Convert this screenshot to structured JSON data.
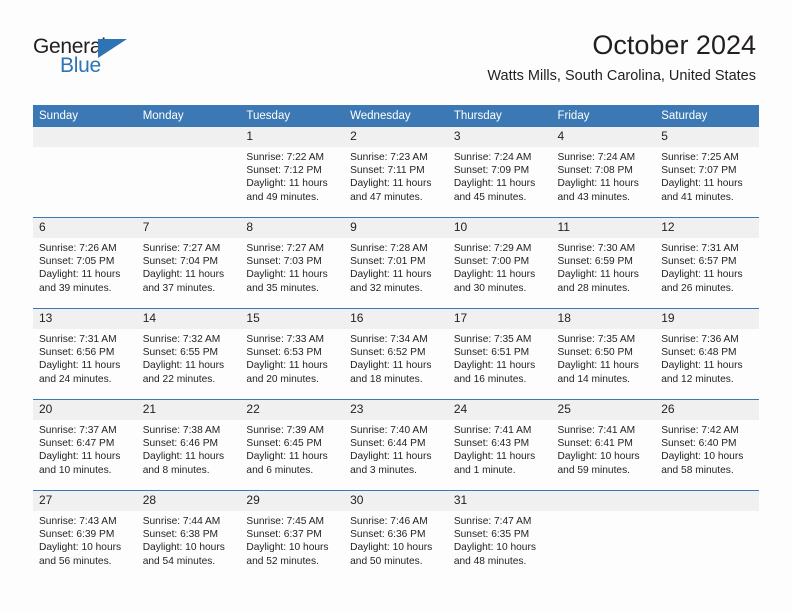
{
  "brand": {
    "name_part1": "General",
    "name_part2": "Blue",
    "accent_color": "#2E74B5"
  },
  "header": {
    "title": "October 2024",
    "subtitle": "Watts Mills, South Carolina, United States"
  },
  "theme": {
    "header_blue": "#3C78B4",
    "daynum_bg": "#F0F0F0",
    "page_bg": "#FDFDFD",
    "text": "#231F20"
  },
  "weekday_headers": [
    "Sunday",
    "Monday",
    "Tuesday",
    "Wednesday",
    "Thursday",
    "Friday",
    "Saturday"
  ],
  "labels": {
    "sunrise": "Sunrise:",
    "sunset": "Sunset:",
    "daylight": "Daylight:"
  },
  "weeks": [
    [
      {
        "day": "",
        "sunrise": "",
        "sunset": "",
        "daylight_1": "",
        "daylight_2": ""
      },
      {
        "day": "",
        "sunrise": "",
        "sunset": "",
        "daylight_1": "",
        "daylight_2": ""
      },
      {
        "day": "1",
        "sunrise": "Sunrise: 7:22 AM",
        "sunset": "Sunset: 7:12 PM",
        "daylight_1": "Daylight: 11 hours",
        "daylight_2": "and 49 minutes."
      },
      {
        "day": "2",
        "sunrise": "Sunrise: 7:23 AM",
        "sunset": "Sunset: 7:11 PM",
        "daylight_1": "Daylight: 11 hours",
        "daylight_2": "and 47 minutes."
      },
      {
        "day": "3",
        "sunrise": "Sunrise: 7:24 AM",
        "sunset": "Sunset: 7:09 PM",
        "daylight_1": "Daylight: 11 hours",
        "daylight_2": "and 45 minutes."
      },
      {
        "day": "4",
        "sunrise": "Sunrise: 7:24 AM",
        "sunset": "Sunset: 7:08 PM",
        "daylight_1": "Daylight: 11 hours",
        "daylight_2": "and 43 minutes."
      },
      {
        "day": "5",
        "sunrise": "Sunrise: 7:25 AM",
        "sunset": "Sunset: 7:07 PM",
        "daylight_1": "Daylight: 11 hours",
        "daylight_2": "and 41 minutes."
      }
    ],
    [
      {
        "day": "6",
        "sunrise": "Sunrise: 7:26 AM",
        "sunset": "Sunset: 7:05 PM",
        "daylight_1": "Daylight: 11 hours",
        "daylight_2": "and 39 minutes."
      },
      {
        "day": "7",
        "sunrise": "Sunrise: 7:27 AM",
        "sunset": "Sunset: 7:04 PM",
        "daylight_1": "Daylight: 11 hours",
        "daylight_2": "and 37 minutes."
      },
      {
        "day": "8",
        "sunrise": "Sunrise: 7:27 AM",
        "sunset": "Sunset: 7:03 PM",
        "daylight_1": "Daylight: 11 hours",
        "daylight_2": "and 35 minutes."
      },
      {
        "day": "9",
        "sunrise": "Sunrise: 7:28 AM",
        "sunset": "Sunset: 7:01 PM",
        "daylight_1": "Daylight: 11 hours",
        "daylight_2": "and 32 minutes."
      },
      {
        "day": "10",
        "sunrise": "Sunrise: 7:29 AM",
        "sunset": "Sunset: 7:00 PM",
        "daylight_1": "Daylight: 11 hours",
        "daylight_2": "and 30 minutes."
      },
      {
        "day": "11",
        "sunrise": "Sunrise: 7:30 AM",
        "sunset": "Sunset: 6:59 PM",
        "daylight_1": "Daylight: 11 hours",
        "daylight_2": "and 28 minutes."
      },
      {
        "day": "12",
        "sunrise": "Sunrise: 7:31 AM",
        "sunset": "Sunset: 6:57 PM",
        "daylight_1": "Daylight: 11 hours",
        "daylight_2": "and 26 minutes."
      }
    ],
    [
      {
        "day": "13",
        "sunrise": "Sunrise: 7:31 AM",
        "sunset": "Sunset: 6:56 PM",
        "daylight_1": "Daylight: 11 hours",
        "daylight_2": "and 24 minutes."
      },
      {
        "day": "14",
        "sunrise": "Sunrise: 7:32 AM",
        "sunset": "Sunset: 6:55 PM",
        "daylight_1": "Daylight: 11 hours",
        "daylight_2": "and 22 minutes."
      },
      {
        "day": "15",
        "sunrise": "Sunrise: 7:33 AM",
        "sunset": "Sunset: 6:53 PM",
        "daylight_1": "Daylight: 11 hours",
        "daylight_2": "and 20 minutes."
      },
      {
        "day": "16",
        "sunrise": "Sunrise: 7:34 AM",
        "sunset": "Sunset: 6:52 PM",
        "daylight_1": "Daylight: 11 hours",
        "daylight_2": "and 18 minutes."
      },
      {
        "day": "17",
        "sunrise": "Sunrise: 7:35 AM",
        "sunset": "Sunset: 6:51 PM",
        "daylight_1": "Daylight: 11 hours",
        "daylight_2": "and 16 minutes."
      },
      {
        "day": "18",
        "sunrise": "Sunrise: 7:35 AM",
        "sunset": "Sunset: 6:50 PM",
        "daylight_1": "Daylight: 11 hours",
        "daylight_2": "and 14 minutes."
      },
      {
        "day": "19",
        "sunrise": "Sunrise: 7:36 AM",
        "sunset": "Sunset: 6:48 PM",
        "daylight_1": "Daylight: 11 hours",
        "daylight_2": "and 12 minutes."
      }
    ],
    [
      {
        "day": "20",
        "sunrise": "Sunrise: 7:37 AM",
        "sunset": "Sunset: 6:47 PM",
        "daylight_1": "Daylight: 11 hours",
        "daylight_2": "and 10 minutes."
      },
      {
        "day": "21",
        "sunrise": "Sunrise: 7:38 AM",
        "sunset": "Sunset: 6:46 PM",
        "daylight_1": "Daylight: 11 hours",
        "daylight_2": "and 8 minutes."
      },
      {
        "day": "22",
        "sunrise": "Sunrise: 7:39 AM",
        "sunset": "Sunset: 6:45 PM",
        "daylight_1": "Daylight: 11 hours",
        "daylight_2": "and 6 minutes."
      },
      {
        "day": "23",
        "sunrise": "Sunrise: 7:40 AM",
        "sunset": "Sunset: 6:44 PM",
        "daylight_1": "Daylight: 11 hours",
        "daylight_2": "and 3 minutes."
      },
      {
        "day": "24",
        "sunrise": "Sunrise: 7:41 AM",
        "sunset": "Sunset: 6:43 PM",
        "daylight_1": "Daylight: 11 hours",
        "daylight_2": "and 1 minute."
      },
      {
        "day": "25",
        "sunrise": "Sunrise: 7:41 AM",
        "sunset": "Sunset: 6:41 PM",
        "daylight_1": "Daylight: 10 hours",
        "daylight_2": "and 59 minutes."
      },
      {
        "day": "26",
        "sunrise": "Sunrise: 7:42 AM",
        "sunset": "Sunset: 6:40 PM",
        "daylight_1": "Daylight: 10 hours",
        "daylight_2": "and 58 minutes."
      }
    ],
    [
      {
        "day": "27",
        "sunrise": "Sunrise: 7:43 AM",
        "sunset": "Sunset: 6:39 PM",
        "daylight_1": "Daylight: 10 hours",
        "daylight_2": "and 56 minutes."
      },
      {
        "day": "28",
        "sunrise": "Sunrise: 7:44 AM",
        "sunset": "Sunset: 6:38 PM",
        "daylight_1": "Daylight: 10 hours",
        "daylight_2": "and 54 minutes."
      },
      {
        "day": "29",
        "sunrise": "Sunrise: 7:45 AM",
        "sunset": "Sunset: 6:37 PM",
        "daylight_1": "Daylight: 10 hours",
        "daylight_2": "and 52 minutes."
      },
      {
        "day": "30",
        "sunrise": "Sunrise: 7:46 AM",
        "sunset": "Sunset: 6:36 PM",
        "daylight_1": "Daylight: 10 hours",
        "daylight_2": "and 50 minutes."
      },
      {
        "day": "31",
        "sunrise": "Sunrise: 7:47 AM",
        "sunset": "Sunset: 6:35 PM",
        "daylight_1": "Daylight: 10 hours",
        "daylight_2": "and 48 minutes."
      },
      {
        "day": "",
        "sunrise": "",
        "sunset": "",
        "daylight_1": "",
        "daylight_2": ""
      },
      {
        "day": "",
        "sunrise": "",
        "sunset": "",
        "daylight_1": "",
        "daylight_2": ""
      }
    ]
  ]
}
